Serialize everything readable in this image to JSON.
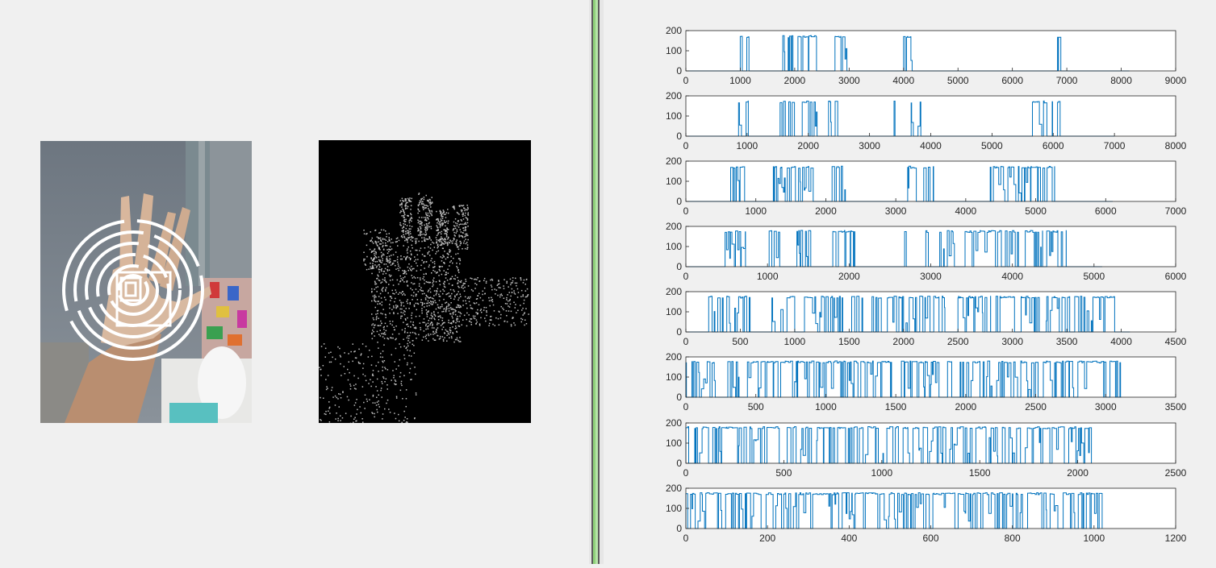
{
  "colors": {
    "background": "#f0f0f0",
    "trace": "#0072bd",
    "axes": "#262626",
    "splitter_accent": "#8ed07a"
  },
  "panels": {
    "photo": {
      "icon": "hand-photo-with-concentric-rings-overlay"
    },
    "mask": {
      "icon": "hand-binary-mask"
    }
  },
  "chart_data": [
    {
      "type": "line",
      "xlim": [
        0,
        9000
      ],
      "ylim": [
        0,
        200
      ],
      "xticks": [
        "0",
        "1000",
        "2000",
        "3000",
        "4000",
        "5000",
        "6000",
        "7000",
        "8000",
        "9000"
      ],
      "yticks": [
        "0",
        "100",
        "200"
      ],
      "length": 8150,
      "peak": 175,
      "bursts": [
        [
          1000,
          1040
        ],
        [
          1120,
          1160
        ],
        [
          1780,
          1840
        ],
        [
          1880,
          1980
        ],
        [
          2060,
          2120
        ],
        [
          2150,
          2250
        ],
        [
          2260,
          2400
        ],
        [
          2740,
          2850
        ],
        [
          2880,
          2960
        ],
        [
          4000,
          4160
        ],
        [
          6830,
          6930
        ]
      ]
    },
    {
      "type": "line",
      "xlim": [
        0,
        8000
      ],
      "ylim": [
        0,
        200
      ],
      "xticks": [
        "0",
        "1000",
        "2000",
        "3000",
        "4000",
        "5000",
        "6000",
        "7000",
        "8000"
      ],
      "yticks": [
        "0",
        "100",
        "200"
      ],
      "length": 7000,
      "peak": 175,
      "bursts": [
        [
          860,
          1020
        ],
        [
          1540,
          1650
        ],
        [
          1680,
          1780
        ],
        [
          1900,
          2150
        ],
        [
          2330,
          2480
        ],
        [
          3400,
          3460
        ],
        [
          3680,
          3880
        ],
        [
          5660,
          5990
        ],
        [
          6070,
          6120
        ]
      ]
    },
    {
      "type": "line",
      "xlim": [
        0,
        7000
      ],
      "ylim": [
        0,
        200
      ],
      "xticks": [
        "0",
        "1000",
        "2000",
        "3000",
        "4000",
        "5000",
        "6000",
        "7000"
      ],
      "yticks": [
        "0",
        "100",
        "200"
      ],
      "length": 6100,
      "peak": 175,
      "bursts": [
        [
          640,
          880
        ],
        [
          1250,
          1420
        ],
        [
          1450,
          1570
        ],
        [
          1610,
          1820
        ],
        [
          2090,
          2280
        ],
        [
          3170,
          3350
        ],
        [
          3400,
          3540
        ],
        [
          4350,
          5270
        ]
      ]
    },
    {
      "type": "line",
      "xlim": [
        0,
        6000
      ],
      "ylim": [
        0,
        200
      ],
      "xticks": [
        "0",
        "1000",
        "2000",
        "3000",
        "4000",
        "5000",
        "6000"
      ],
      "yticks": [
        "0",
        "100",
        "200"
      ],
      "length": 5100,
      "peak": 180,
      "bursts": [
        [
          480,
          730
        ],
        [
          1020,
          1150
        ],
        [
          1360,
          1530
        ],
        [
          1800,
          2070
        ],
        [
          2680,
          2700
        ],
        [
          2940,
          2970
        ],
        [
          3110,
          3300
        ],
        [
          3420,
          4370
        ],
        [
          4420,
          4660
        ]
      ]
    },
    {
      "type": "line",
      "xlim": [
        0,
        4500
      ],
      "ylim": [
        0,
        200
      ],
      "xticks": [
        "0",
        "500",
        "1000",
        "1500",
        "2000",
        "2500",
        "3000",
        "3500",
        "4000",
        "4500"
      ],
      "yticks": [
        "0",
        "100",
        "200"
      ],
      "length": 4080,
      "peak": 178,
      "bursts": [
        [
          210,
          590
        ],
        [
          790,
          1000
        ],
        [
          1090,
          1360
        ],
        [
          1360,
          1640
        ],
        [
          1710,
          2380
        ],
        [
          2500,
          2800
        ],
        [
          2850,
          3950
        ]
      ]
    },
    {
      "type": "line",
      "xlim": [
        0,
        3500
      ],
      "ylim": [
        0,
        200
      ],
      "xticks": [
        "0",
        "500",
        "1000",
        "1500",
        "2000",
        "2500",
        "3000",
        "3500"
      ],
      "yticks": [
        "0",
        "100",
        "200"
      ],
      "length": 3110,
      "peak": 180,
      "bursts": [
        [
          0,
          210
        ],
        [
          300,
          380
        ],
        [
          440,
          1470
        ],
        [
          1540,
          1900
        ],
        [
          1960,
          3110
        ]
      ]
    },
    {
      "type": "line",
      "xlim": [
        0,
        2500
      ],
      "ylim": [
        0,
        200
      ],
      "xticks": [
        "0",
        "500",
        "1000",
        "1500",
        "2000",
        "2500"
      ],
      "yticks": [
        "0",
        "100",
        "200"
      ],
      "length": 2070,
      "peak": 182,
      "bursts": [
        [
          0,
          2070
        ]
      ]
    },
    {
      "type": "line",
      "xlim": [
        0,
        1200
      ],
      "ylim": [
        0,
        200
      ],
      "xticks": [
        "0",
        "200",
        "400",
        "600",
        "800",
        "1000",
        "1200"
      ],
      "yticks": [
        "0",
        "100",
        "200"
      ],
      "length": 1020,
      "peak": 178,
      "bursts": [
        [
          0,
          1020
        ]
      ]
    }
  ]
}
